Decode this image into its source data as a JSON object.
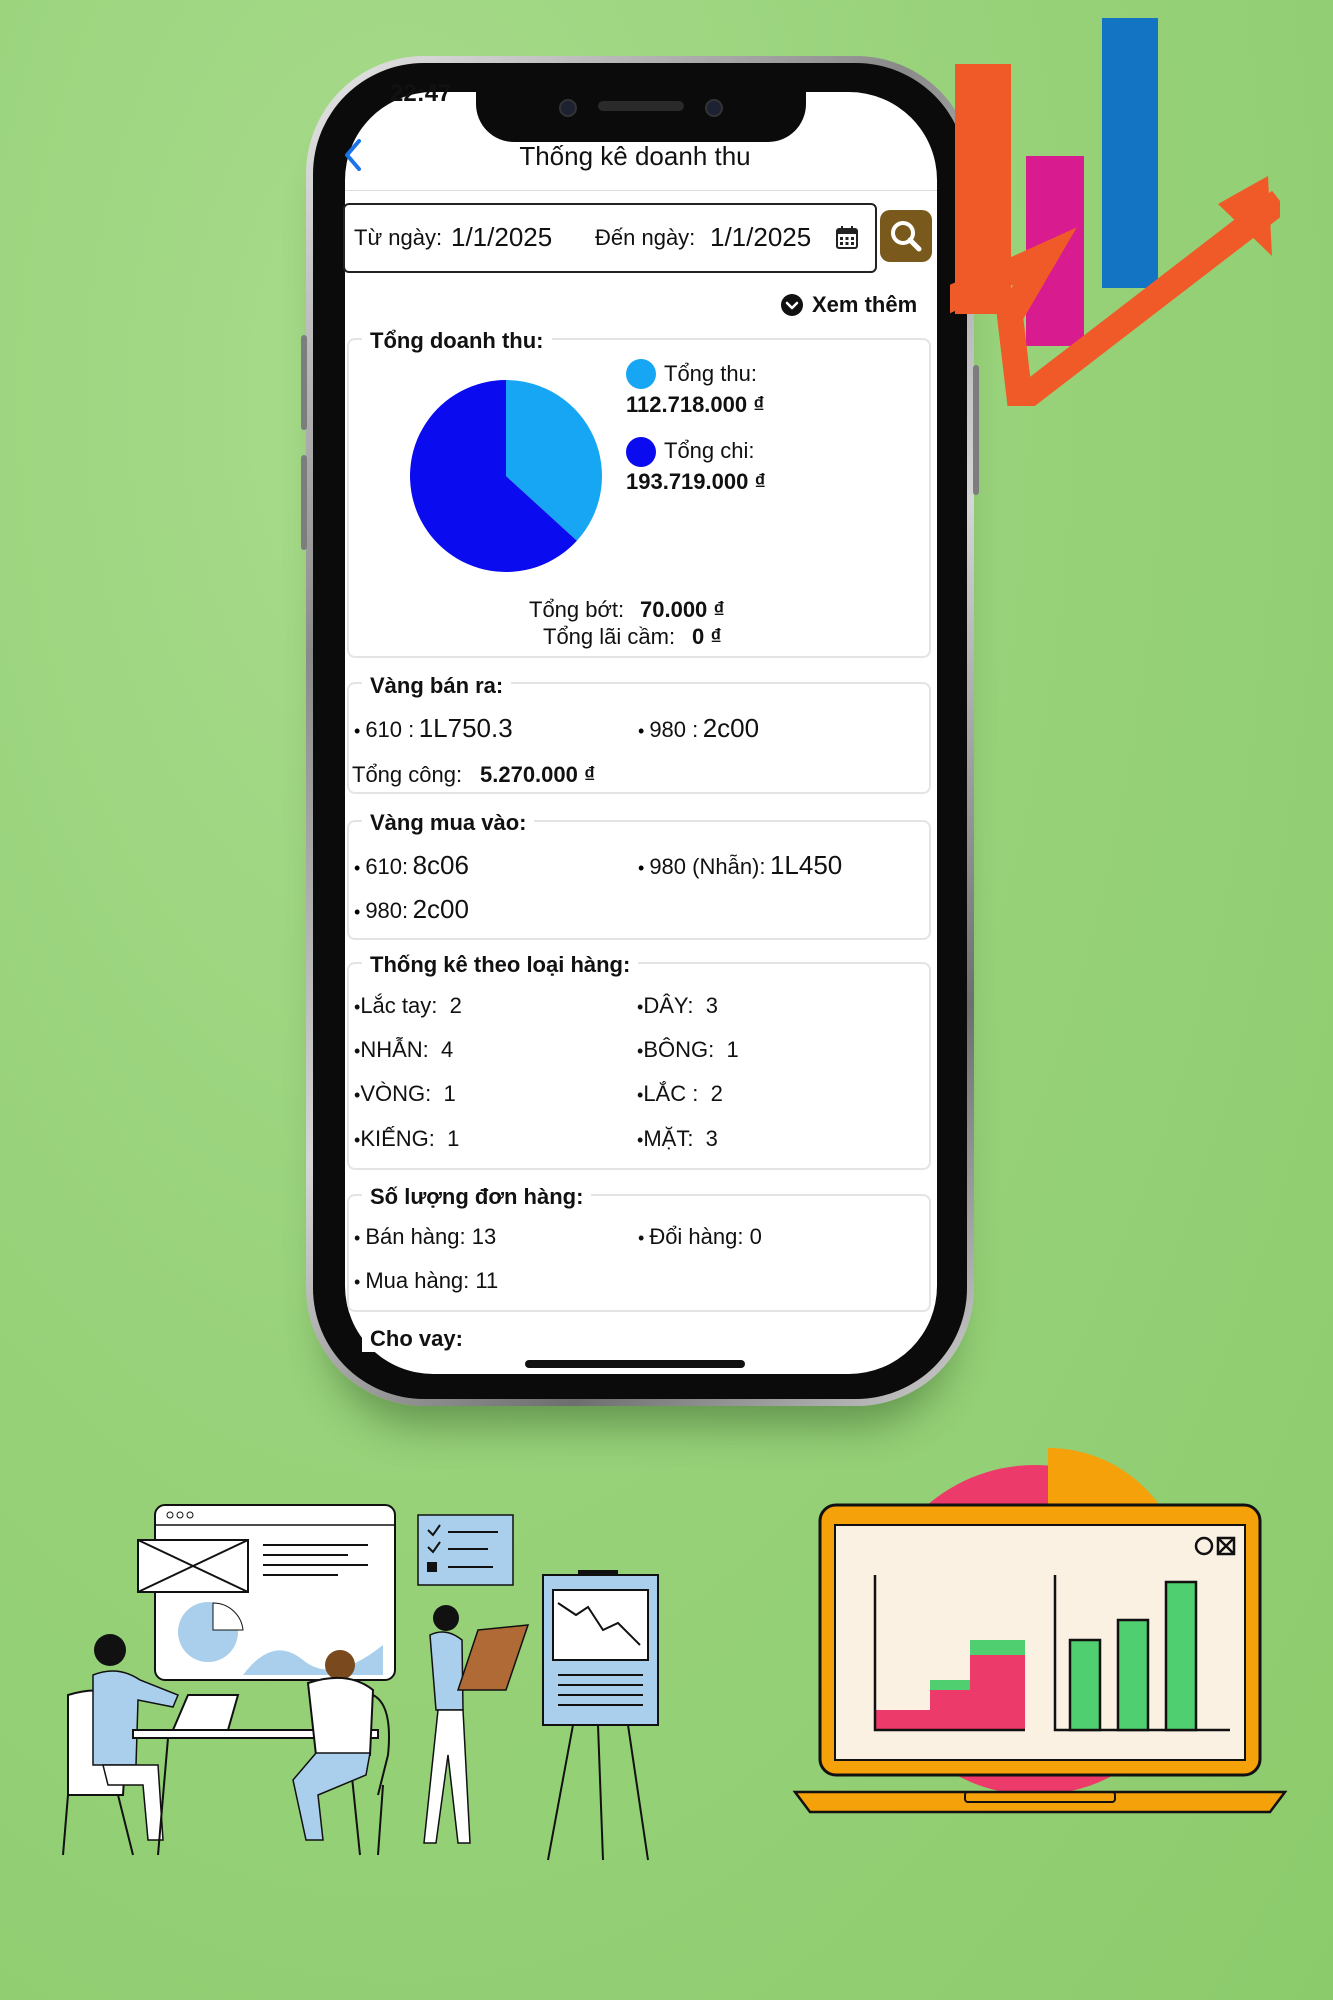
{
  "status": {
    "time": "22:47"
  },
  "header": {
    "back_icon": "chevron-left-icon",
    "title": "Thống kê doanh thu"
  },
  "filter": {
    "from_label": "Từ ngày:",
    "from_value": "1/1/2025",
    "to_label": "Đến ngày:",
    "to_value": "1/1/2025",
    "calendar_icon": "calendar-icon",
    "search_icon": "search-icon",
    "more_label": "Xem thêm"
  },
  "revenue": {
    "title": "Tổng doanh thu:",
    "income_label": "Tổng thu:",
    "income_value": "112.718.000 ₫",
    "expense_label": "Tổng chi:",
    "expense_value": "193.719.000 ₫",
    "discount_label": "Tổng bớt:",
    "discount_value": "70.000 ₫",
    "pawn_label": "Tổng lãi cầm:",
    "pawn_value": "0 ₫",
    "colors": {
      "income": "#16a6f4",
      "expense": "#0b0bf0"
    }
  },
  "chart_data": {
    "type": "pie",
    "categories": [
      "Tổng thu",
      "Tổng chi"
    ],
    "values": [
      112718000,
      193719000
    ],
    "colors": [
      "#16a6f4",
      "#0b0bf0"
    ]
  },
  "gold_sold": {
    "title": "Vàng bán ra:",
    "items": [
      {
        "code": "610 :",
        "value": "1L750.3"
      },
      {
        "code": "980 :",
        "value": "2c00"
      }
    ],
    "total_label": "Tổng công:",
    "total_value": "5.270.000 ₫"
  },
  "gold_bought": {
    "title": "Vàng mua vào:",
    "items": [
      {
        "code": "610:",
        "value": "8c06"
      },
      {
        "code": "980 (Nhẫn):",
        "value": "1L450"
      },
      {
        "code": "980:",
        "value": "2c00"
      }
    ]
  },
  "by_type": {
    "title": "Thống kê theo loại hàng:",
    "items": [
      {
        "name": "Lắc tay:",
        "count": "2"
      },
      {
        "name": "DÂY:",
        "count": "3"
      },
      {
        "name": "NHẪN:",
        "count": "4"
      },
      {
        "name": "BÔNG:",
        "count": "1"
      },
      {
        "name": "VÒNG:",
        "count": "1"
      },
      {
        "name": "LẮC :",
        "count": "2"
      },
      {
        "name": "KIẾNG:",
        "count": "1"
      },
      {
        "name": "MẶT:",
        "count": "3"
      }
    ]
  },
  "orders": {
    "title": "Số lượng đơn hàng:",
    "items": [
      {
        "name": "Bán hàng:",
        "count": "13"
      },
      {
        "name": "Đổi hàng:",
        "count": "0"
      },
      {
        "name": "Mua hàng:",
        "count": "11"
      }
    ]
  },
  "loan": {
    "title": "Cho vay:"
  },
  "decor": {
    "top_right": "growth-chart-icon",
    "bottom_left": "team-meeting-illustration",
    "bottom_right": "laptop-analytics-illustration"
  }
}
